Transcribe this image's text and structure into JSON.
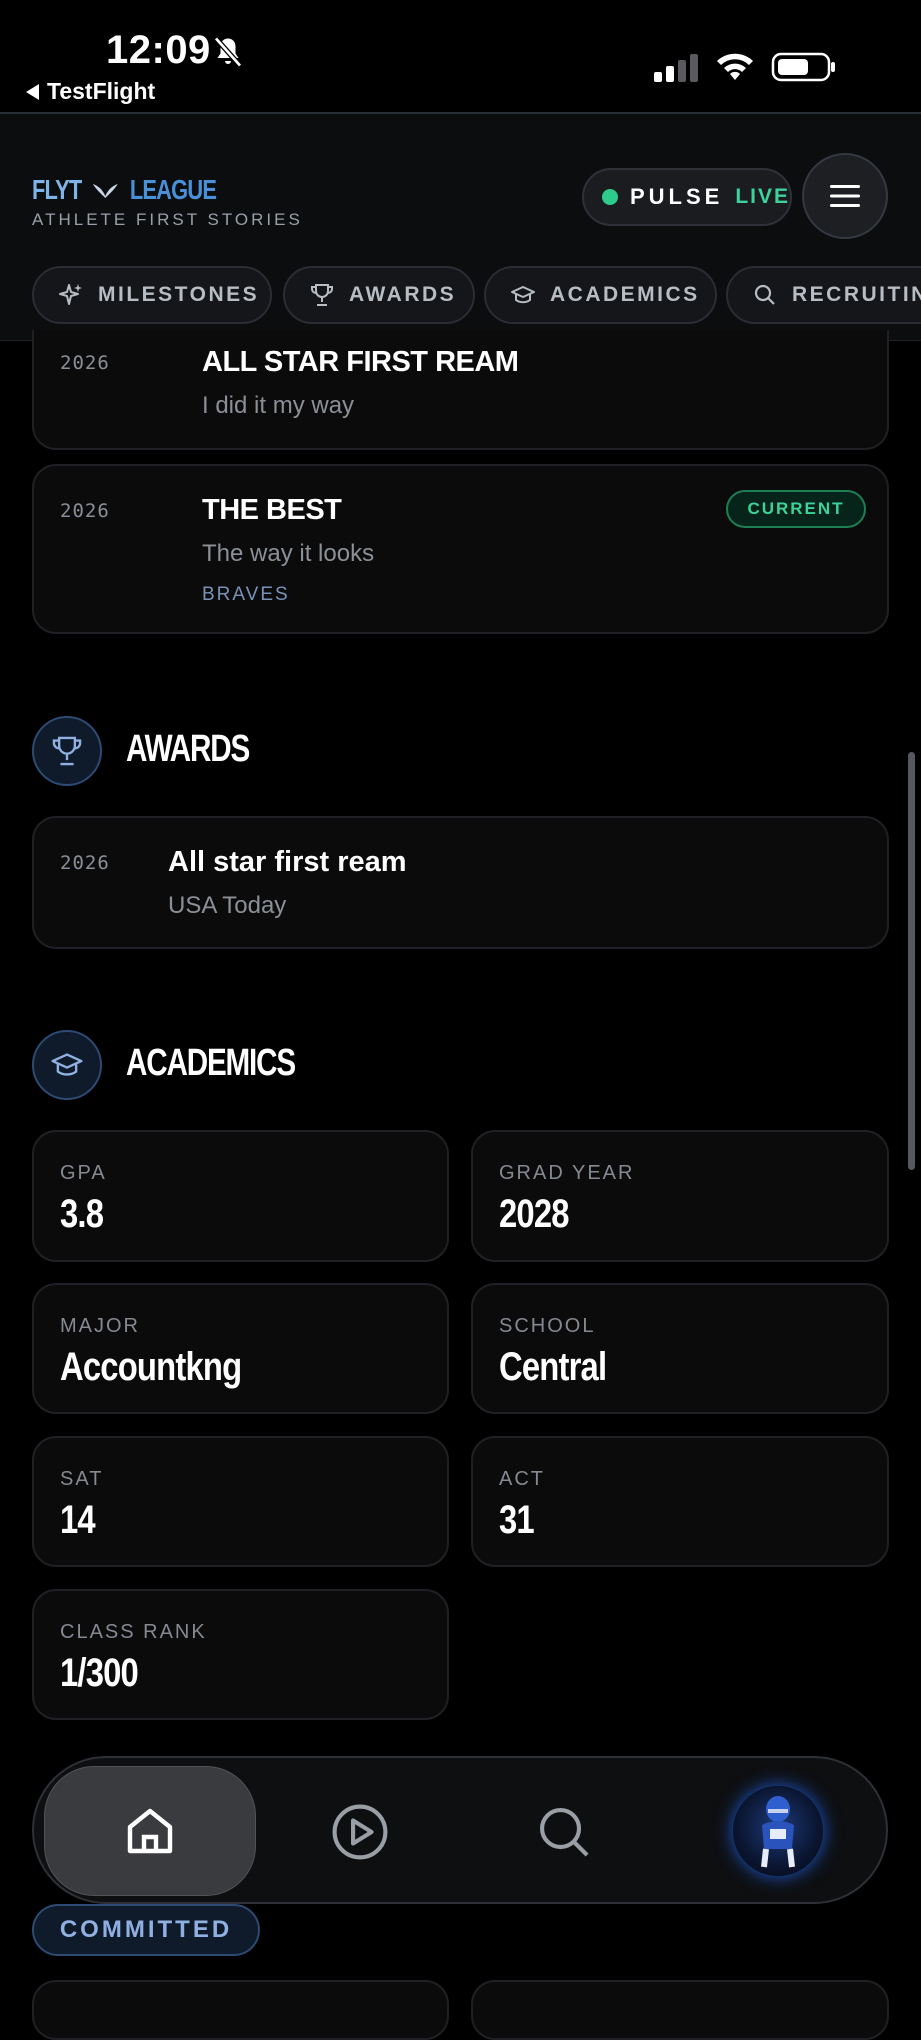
{
  "status_bar": {
    "time": "12:09",
    "back_label": "TestFlight"
  },
  "header": {
    "logo_word1": "FLYT",
    "logo_word2": "LEAGUE",
    "tagline": "ATHLETE FIRST STORIES",
    "pulse_label": "PULSE",
    "live_label": "LIVE"
  },
  "tabs": [
    {
      "label": "MILESTONES",
      "icon": "sparkle-icon"
    },
    {
      "label": "AWARDS",
      "icon": "trophy-icon"
    },
    {
      "label": "ACADEMICS",
      "icon": "graduation-cap-icon"
    },
    {
      "label": "RECRUITIN",
      "icon": "search-icon"
    }
  ],
  "milestones": [
    {
      "year": "2026",
      "title": "ALL STAR FIRST REAM",
      "subtitle": "I did it my way"
    },
    {
      "year": "2026",
      "title": "THE BEST",
      "subtitle": "The way it looks",
      "org": "BRAVES",
      "badge": "CURRENT"
    }
  ],
  "awards": {
    "title": "AWARDS",
    "items": [
      {
        "year": "2026",
        "title": "All star first ream",
        "source": "USA Today"
      }
    ]
  },
  "academics": {
    "title": "ACADEMICS",
    "stats": [
      {
        "label": "GPA",
        "value": "3.8"
      },
      {
        "label": "GRAD YEAR",
        "value": "2028"
      },
      {
        "label": "MAJOR",
        "value": "Accountkng"
      },
      {
        "label": "SCHOOL",
        "value": "Central"
      },
      {
        "label": "SAT",
        "value": "14"
      },
      {
        "label": "ACT",
        "value": "31"
      },
      {
        "label": "CLASS RANK",
        "value": "1/300"
      }
    ]
  },
  "committed_badge": "COMMITTED",
  "bottom_nav": {
    "items": [
      "home-icon",
      "play-icon",
      "search-icon",
      "avatar"
    ]
  },
  "colors": {
    "accent_blue": "#4a90d9",
    "live_green": "#3dd29a",
    "background": "#000000"
  }
}
